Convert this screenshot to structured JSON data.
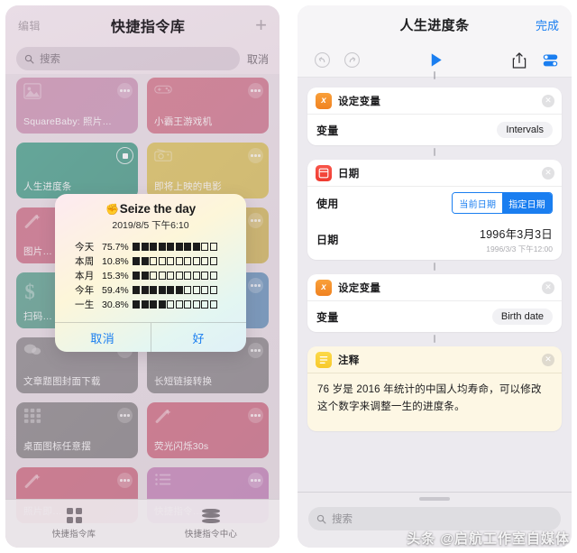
{
  "left_phone": {
    "header": {
      "edit_label": "编辑",
      "title": "快捷指令库",
      "add_label": "+"
    },
    "search": {
      "placeholder": "搜索",
      "cancel_label": "取消",
      "icon": "search-icon"
    },
    "cards": [
      {
        "name": "SquareBaby: 照片…",
        "color": "#c4799f",
        "color2": "#bd7aa6",
        "glyph": "photo-icon",
        "menu": "more-dots-icon",
        "running": false
      },
      {
        "name": "小霸王游戏机",
        "color": "#c9516b",
        "color2": "#c0506e",
        "glyph": "gamepad-icon",
        "menu": "more-dots-icon",
        "running": false
      },
      {
        "name": "人生进度条",
        "color": "#138a6d",
        "color2": "#0f7e63",
        "glyph": "",
        "menu": "",
        "running": true
      },
      {
        "name": "即将上映的电影",
        "color": "#d3b430",
        "color2": "#cdae2c",
        "glyph": "camera-icon",
        "menu": "more-dots-icon",
        "running": false
      },
      {
        "name": "图片…",
        "color": "#c34b68",
        "color2": "#bb4a6b",
        "glyph": "wand-icon",
        "menu": "more-dots-icon",
        "running": false
      },
      {
        "name": "",
        "color": "#c9a62c",
        "color2": "#c0a02b",
        "glyph": "",
        "menu": "more-dots-icon",
        "running": false
      },
      {
        "name": "扫码…",
        "color": "#2f8a72",
        "color2": "#2a8069",
        "glyph": "dollar-icon",
        "menu": "more-dots-icon",
        "running": false
      },
      {
        "name": "",
        "color": "#3d78ab",
        "color2": "#3a72a4",
        "glyph": "",
        "menu": "more-dots-icon",
        "running": false
      },
      {
        "name": "文章题图封面下载",
        "color": "#6e6a6e",
        "color2": "#686468",
        "glyph": "chat-icon",
        "menu": "more-dots-icon",
        "running": false
      },
      {
        "name": "长短链接转换",
        "color": "#6e6a6e",
        "color2": "#686468",
        "glyph": "",
        "menu": "more-dots-icon",
        "running": false
      },
      {
        "name": "桌面图标任意摆",
        "color": "#6a6669",
        "color2": "#646063",
        "glyph": "grid-icon",
        "menu": "more-dots-icon",
        "running": false
      },
      {
        "name": "荧光闪烁30s",
        "color": "#c2445f",
        "color2": "#ba4462",
        "glyph": "wand-icon",
        "menu": "more-dots-icon",
        "running": false
      },
      {
        "name": "照片即…",
        "color": "#c2445f",
        "color2": "#ba4462",
        "glyph": "wand-icon",
        "menu": "more-dots-icon",
        "running": false
      },
      {
        "name": "快捷指令…",
        "color": "#b563a4",
        "color2": "#ae61a4",
        "glyph": "list-icon",
        "menu": "more-dots-icon",
        "running": false
      }
    ],
    "tabs": [
      {
        "label": "快捷指令库",
        "icon": "grid-icon",
        "active": true
      },
      {
        "label": "快捷指令中心",
        "icon": "stack-icon",
        "active": false
      }
    ]
  },
  "alert": {
    "emoji": "✊",
    "title": "Seize the day",
    "timestamp": "2019/8/5 下午6:10",
    "rows": [
      {
        "label": "今天",
        "percent": "75.7%",
        "filled": 8,
        "total": 10
      },
      {
        "label": "本周",
        "percent": "10.8%",
        "filled": 2,
        "total": 10
      },
      {
        "label": "本月",
        "percent": "15.3%",
        "filled": 2,
        "total": 10
      },
      {
        "label": "今年",
        "percent": "59.4%",
        "filled": 6,
        "total": 10
      },
      {
        "label": "一生",
        "percent": "30.8%",
        "filled": 4,
        "total": 10
      }
    ],
    "cancel_label": "取消",
    "ok_label": "好"
  },
  "right_phone": {
    "header": {
      "title": "人生进度条",
      "done_label": "完成"
    },
    "toolbar": [
      {
        "name": "undo-icon",
        "enabled": false
      },
      {
        "name": "redo-icon",
        "enabled": false
      },
      {
        "name": "play-icon",
        "enabled": true
      },
      {
        "name": "share-icon",
        "enabled": true
      },
      {
        "name": "settings-toggles-icon",
        "enabled": true
      }
    ],
    "actions": [
      {
        "kind": "set-variable",
        "icon_glyph": "x",
        "title": "设定变量",
        "rows": [
          {
            "label": "变量",
            "value": "Intervals",
            "type": "pill"
          }
        ]
      },
      {
        "kind": "date",
        "icon_glyph": "",
        "title": "日期",
        "rows": [
          {
            "label": "使用",
            "type": "segment",
            "options": [
              "当前日期",
              "指定日期"
            ],
            "selected": "指定日期"
          },
          {
            "label": "日期",
            "type": "date",
            "value": "1996年3月3日",
            "sub": "1996/3/3 下午12:00"
          }
        ]
      },
      {
        "kind": "set-variable",
        "icon_glyph": "x",
        "title": "设定变量",
        "rows": [
          {
            "label": "变量",
            "value": "Birth date",
            "type": "pill"
          }
        ]
      },
      {
        "kind": "comment",
        "icon_glyph": "",
        "title": "注释",
        "text": "76 岁是 2016 年统计的中国人均寿命，可以修改这个数字来调整一生的进度条。"
      }
    ],
    "search": {
      "placeholder": "搜索",
      "icon": "search-icon"
    },
    "close_icon": "close-circle-icon"
  },
  "watermark": {
    "text": "头条 @启航工作室自媒体"
  },
  "colors": {
    "accent_blue": "#1a7ef0",
    "orange": "#f08221",
    "red": "#ef3b30",
    "yellow": "#f7c92b",
    "note_bg": "#fdf7e4"
  }
}
